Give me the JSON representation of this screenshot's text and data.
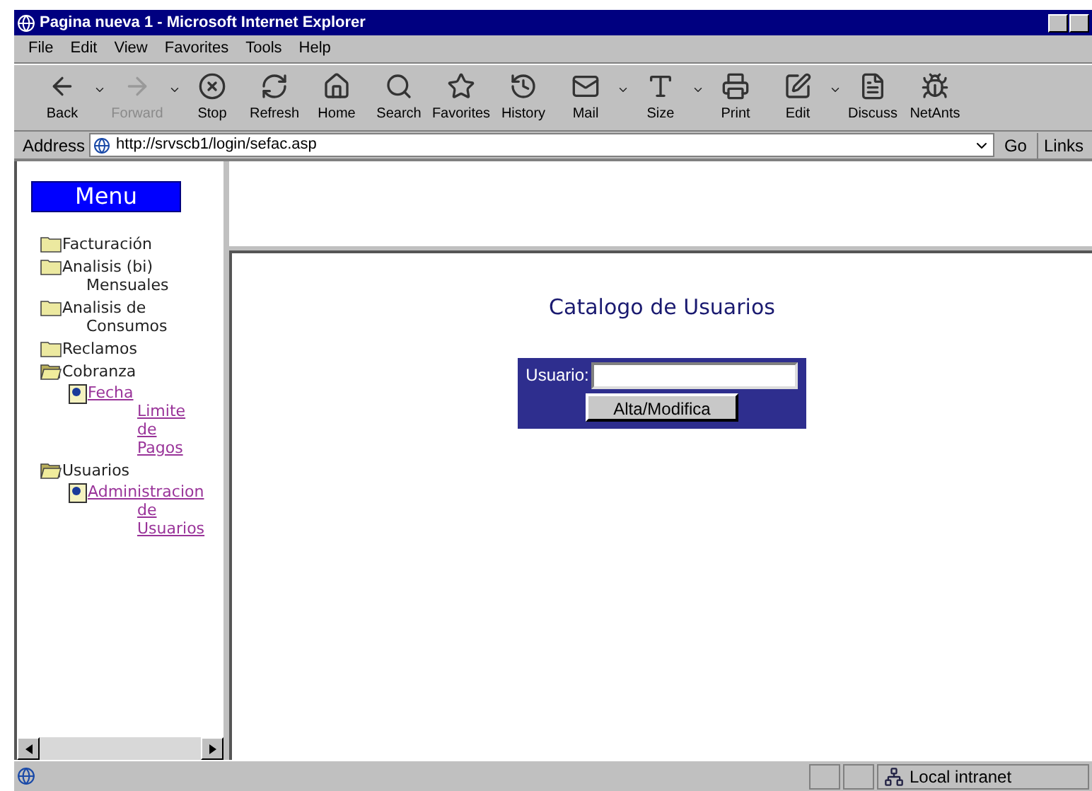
{
  "window": {
    "title": "Pagina nueva 1 - Microsoft Internet Explorer"
  },
  "menu": [
    "File",
    "Edit",
    "View",
    "Favorites",
    "Tools",
    "Help"
  ],
  "toolbar": [
    {
      "label": "Back",
      "disabled": false,
      "dropdown": true
    },
    {
      "label": "Forward",
      "disabled": true,
      "dropdown": true
    },
    {
      "label": "Stop",
      "disabled": false,
      "dropdown": false
    },
    {
      "label": "Refresh",
      "disabled": false,
      "dropdown": false
    },
    {
      "label": "Home",
      "disabled": false,
      "dropdown": false
    },
    {
      "label": "Search",
      "disabled": false,
      "dropdown": false
    },
    {
      "label": "Favorites",
      "disabled": false,
      "dropdown": false
    },
    {
      "label": "History",
      "disabled": false,
      "dropdown": false
    },
    {
      "label": "Mail",
      "disabled": false,
      "dropdown": true
    },
    {
      "label": "Size",
      "disabled": false,
      "dropdown": true
    },
    {
      "label": "Print",
      "disabled": false,
      "dropdown": false
    },
    {
      "label": "Edit",
      "disabled": false,
      "dropdown": true
    },
    {
      "label": "Discuss",
      "disabled": false,
      "dropdown": false
    },
    {
      "label": "NetAnts",
      "disabled": false,
      "dropdown": false
    }
  ],
  "address": {
    "label": "Address",
    "url": "http://srvscb1/login/sefac.asp",
    "go": "Go",
    "links": "Links"
  },
  "sidebar": {
    "heading": "Menu",
    "items": [
      {
        "kind": "folder",
        "label": "Facturación",
        "expanded": false
      },
      {
        "kind": "folder",
        "label": "Analisis (bi) Mensuales",
        "expanded": false
      },
      {
        "kind": "folder",
        "label": "Analisis de Consumos",
        "expanded": false
      },
      {
        "kind": "folder",
        "label": "Reclamos",
        "expanded": false
      },
      {
        "kind": "folder",
        "label": "Cobranza",
        "expanded": true,
        "children": [
          {
            "kind": "link",
            "label": "Fecha Limite de Pagos"
          }
        ]
      },
      {
        "kind": "folder",
        "label": "Usuarios",
        "expanded": true,
        "children": [
          {
            "kind": "link",
            "label": "Administracion de Usuarios"
          }
        ]
      }
    ]
  },
  "content": {
    "title": "Catalogo de Usuarios",
    "form": {
      "label": "Usuario:",
      "button": "Alta/Modifica"
    }
  },
  "status_bar": {
    "zone": "Local intranet"
  }
}
